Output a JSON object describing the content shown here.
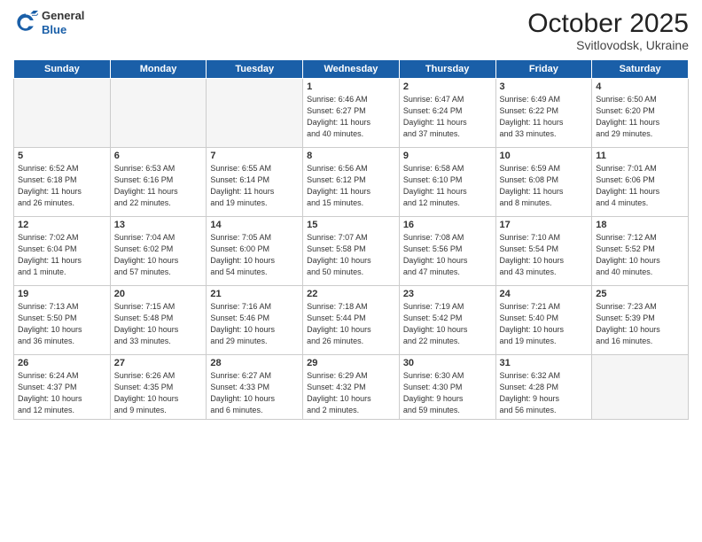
{
  "header": {
    "logo_line1": "General",
    "logo_line2": "Blue",
    "month": "October 2025",
    "location": "Svitlovodsk, Ukraine"
  },
  "weekdays": [
    "Sunday",
    "Monday",
    "Tuesday",
    "Wednesday",
    "Thursday",
    "Friday",
    "Saturday"
  ],
  "weeks": [
    [
      {
        "day": "",
        "info": ""
      },
      {
        "day": "",
        "info": ""
      },
      {
        "day": "",
        "info": ""
      },
      {
        "day": "1",
        "info": "Sunrise: 6:46 AM\nSunset: 6:27 PM\nDaylight: 11 hours\nand 40 minutes."
      },
      {
        "day": "2",
        "info": "Sunrise: 6:47 AM\nSunset: 6:24 PM\nDaylight: 11 hours\nand 37 minutes."
      },
      {
        "day": "3",
        "info": "Sunrise: 6:49 AM\nSunset: 6:22 PM\nDaylight: 11 hours\nand 33 minutes."
      },
      {
        "day": "4",
        "info": "Sunrise: 6:50 AM\nSunset: 6:20 PM\nDaylight: 11 hours\nand 29 minutes."
      }
    ],
    [
      {
        "day": "5",
        "info": "Sunrise: 6:52 AM\nSunset: 6:18 PM\nDaylight: 11 hours\nand 26 minutes."
      },
      {
        "day": "6",
        "info": "Sunrise: 6:53 AM\nSunset: 6:16 PM\nDaylight: 11 hours\nand 22 minutes."
      },
      {
        "day": "7",
        "info": "Sunrise: 6:55 AM\nSunset: 6:14 PM\nDaylight: 11 hours\nand 19 minutes."
      },
      {
        "day": "8",
        "info": "Sunrise: 6:56 AM\nSunset: 6:12 PM\nDaylight: 11 hours\nand 15 minutes."
      },
      {
        "day": "9",
        "info": "Sunrise: 6:58 AM\nSunset: 6:10 PM\nDaylight: 11 hours\nand 12 minutes."
      },
      {
        "day": "10",
        "info": "Sunrise: 6:59 AM\nSunset: 6:08 PM\nDaylight: 11 hours\nand 8 minutes."
      },
      {
        "day": "11",
        "info": "Sunrise: 7:01 AM\nSunset: 6:06 PM\nDaylight: 11 hours\nand 4 minutes."
      }
    ],
    [
      {
        "day": "12",
        "info": "Sunrise: 7:02 AM\nSunset: 6:04 PM\nDaylight: 11 hours\nand 1 minute."
      },
      {
        "day": "13",
        "info": "Sunrise: 7:04 AM\nSunset: 6:02 PM\nDaylight: 10 hours\nand 57 minutes."
      },
      {
        "day": "14",
        "info": "Sunrise: 7:05 AM\nSunset: 6:00 PM\nDaylight: 10 hours\nand 54 minutes."
      },
      {
        "day": "15",
        "info": "Sunrise: 7:07 AM\nSunset: 5:58 PM\nDaylight: 10 hours\nand 50 minutes."
      },
      {
        "day": "16",
        "info": "Sunrise: 7:08 AM\nSunset: 5:56 PM\nDaylight: 10 hours\nand 47 minutes."
      },
      {
        "day": "17",
        "info": "Sunrise: 7:10 AM\nSunset: 5:54 PM\nDaylight: 10 hours\nand 43 minutes."
      },
      {
        "day": "18",
        "info": "Sunrise: 7:12 AM\nSunset: 5:52 PM\nDaylight: 10 hours\nand 40 minutes."
      }
    ],
    [
      {
        "day": "19",
        "info": "Sunrise: 7:13 AM\nSunset: 5:50 PM\nDaylight: 10 hours\nand 36 minutes."
      },
      {
        "day": "20",
        "info": "Sunrise: 7:15 AM\nSunset: 5:48 PM\nDaylight: 10 hours\nand 33 minutes."
      },
      {
        "day": "21",
        "info": "Sunrise: 7:16 AM\nSunset: 5:46 PM\nDaylight: 10 hours\nand 29 minutes."
      },
      {
        "day": "22",
        "info": "Sunrise: 7:18 AM\nSunset: 5:44 PM\nDaylight: 10 hours\nand 26 minutes."
      },
      {
        "day": "23",
        "info": "Sunrise: 7:19 AM\nSunset: 5:42 PM\nDaylight: 10 hours\nand 22 minutes."
      },
      {
        "day": "24",
        "info": "Sunrise: 7:21 AM\nSunset: 5:40 PM\nDaylight: 10 hours\nand 19 minutes."
      },
      {
        "day": "25",
        "info": "Sunrise: 7:23 AM\nSunset: 5:39 PM\nDaylight: 10 hours\nand 16 minutes."
      }
    ],
    [
      {
        "day": "26",
        "info": "Sunrise: 6:24 AM\nSunset: 4:37 PM\nDaylight: 10 hours\nand 12 minutes."
      },
      {
        "day": "27",
        "info": "Sunrise: 6:26 AM\nSunset: 4:35 PM\nDaylight: 10 hours\nand 9 minutes."
      },
      {
        "day": "28",
        "info": "Sunrise: 6:27 AM\nSunset: 4:33 PM\nDaylight: 10 hours\nand 6 minutes."
      },
      {
        "day": "29",
        "info": "Sunrise: 6:29 AM\nSunset: 4:32 PM\nDaylight: 10 hours\nand 2 minutes."
      },
      {
        "day": "30",
        "info": "Sunrise: 6:30 AM\nSunset: 4:30 PM\nDaylight: 9 hours\nand 59 minutes."
      },
      {
        "day": "31",
        "info": "Sunrise: 6:32 AM\nSunset: 4:28 PM\nDaylight: 9 hours\nand 56 minutes."
      },
      {
        "day": "",
        "info": ""
      }
    ]
  ]
}
